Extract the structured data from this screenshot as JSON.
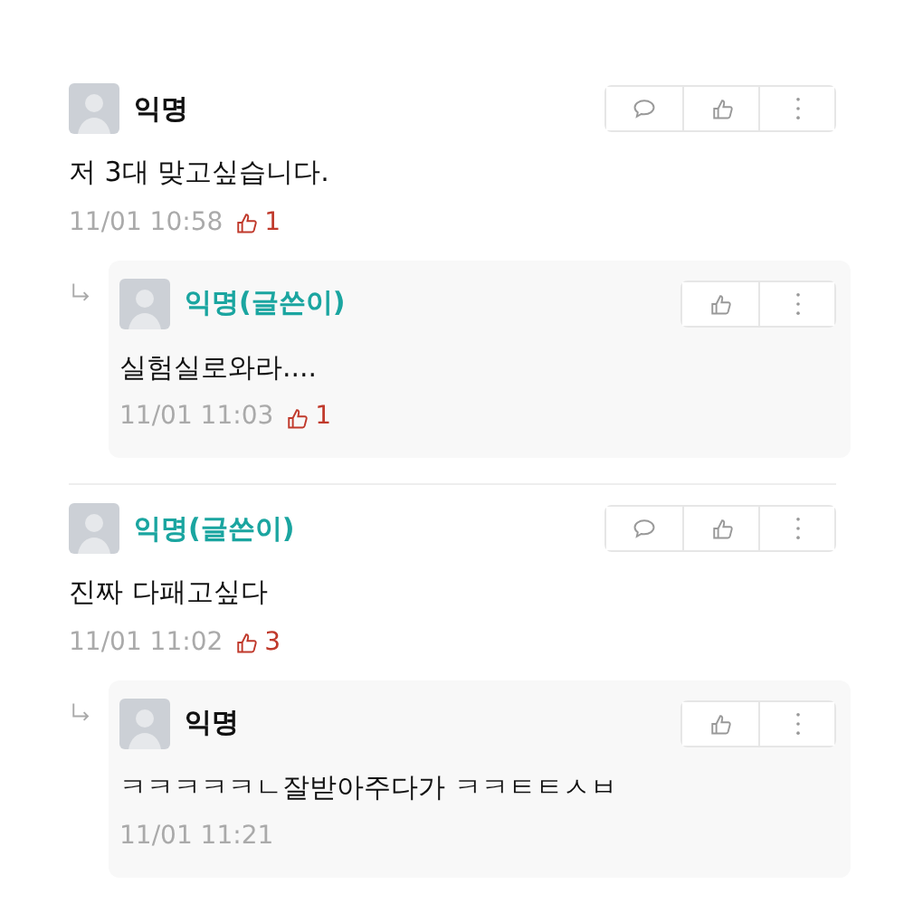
{
  "comments": [
    {
      "author": "익명",
      "is_writer": false,
      "text": "저 3대 맞고싶습니다.",
      "time": "11/01 10:58",
      "likes": "1",
      "replies": [
        {
          "author": "익명(글쓴이)",
          "is_writer": true,
          "text": "실험실로와라....",
          "time": "11/01 11:03",
          "likes": "1"
        }
      ]
    },
    {
      "author": "익명(글쓴이)",
      "is_writer": true,
      "text": "진짜 다패고싶다",
      "time": "11/01 11:02",
      "likes": "3",
      "replies": [
        {
          "author": "익명",
          "is_writer": false,
          "text": "ㅋㅋㅋㅋㅋㄴ잘받아주다가 ㅋㅋㅌㅌㅅㅂ",
          "time": "11/01 11:21"
        }
      ]
    }
  ]
}
